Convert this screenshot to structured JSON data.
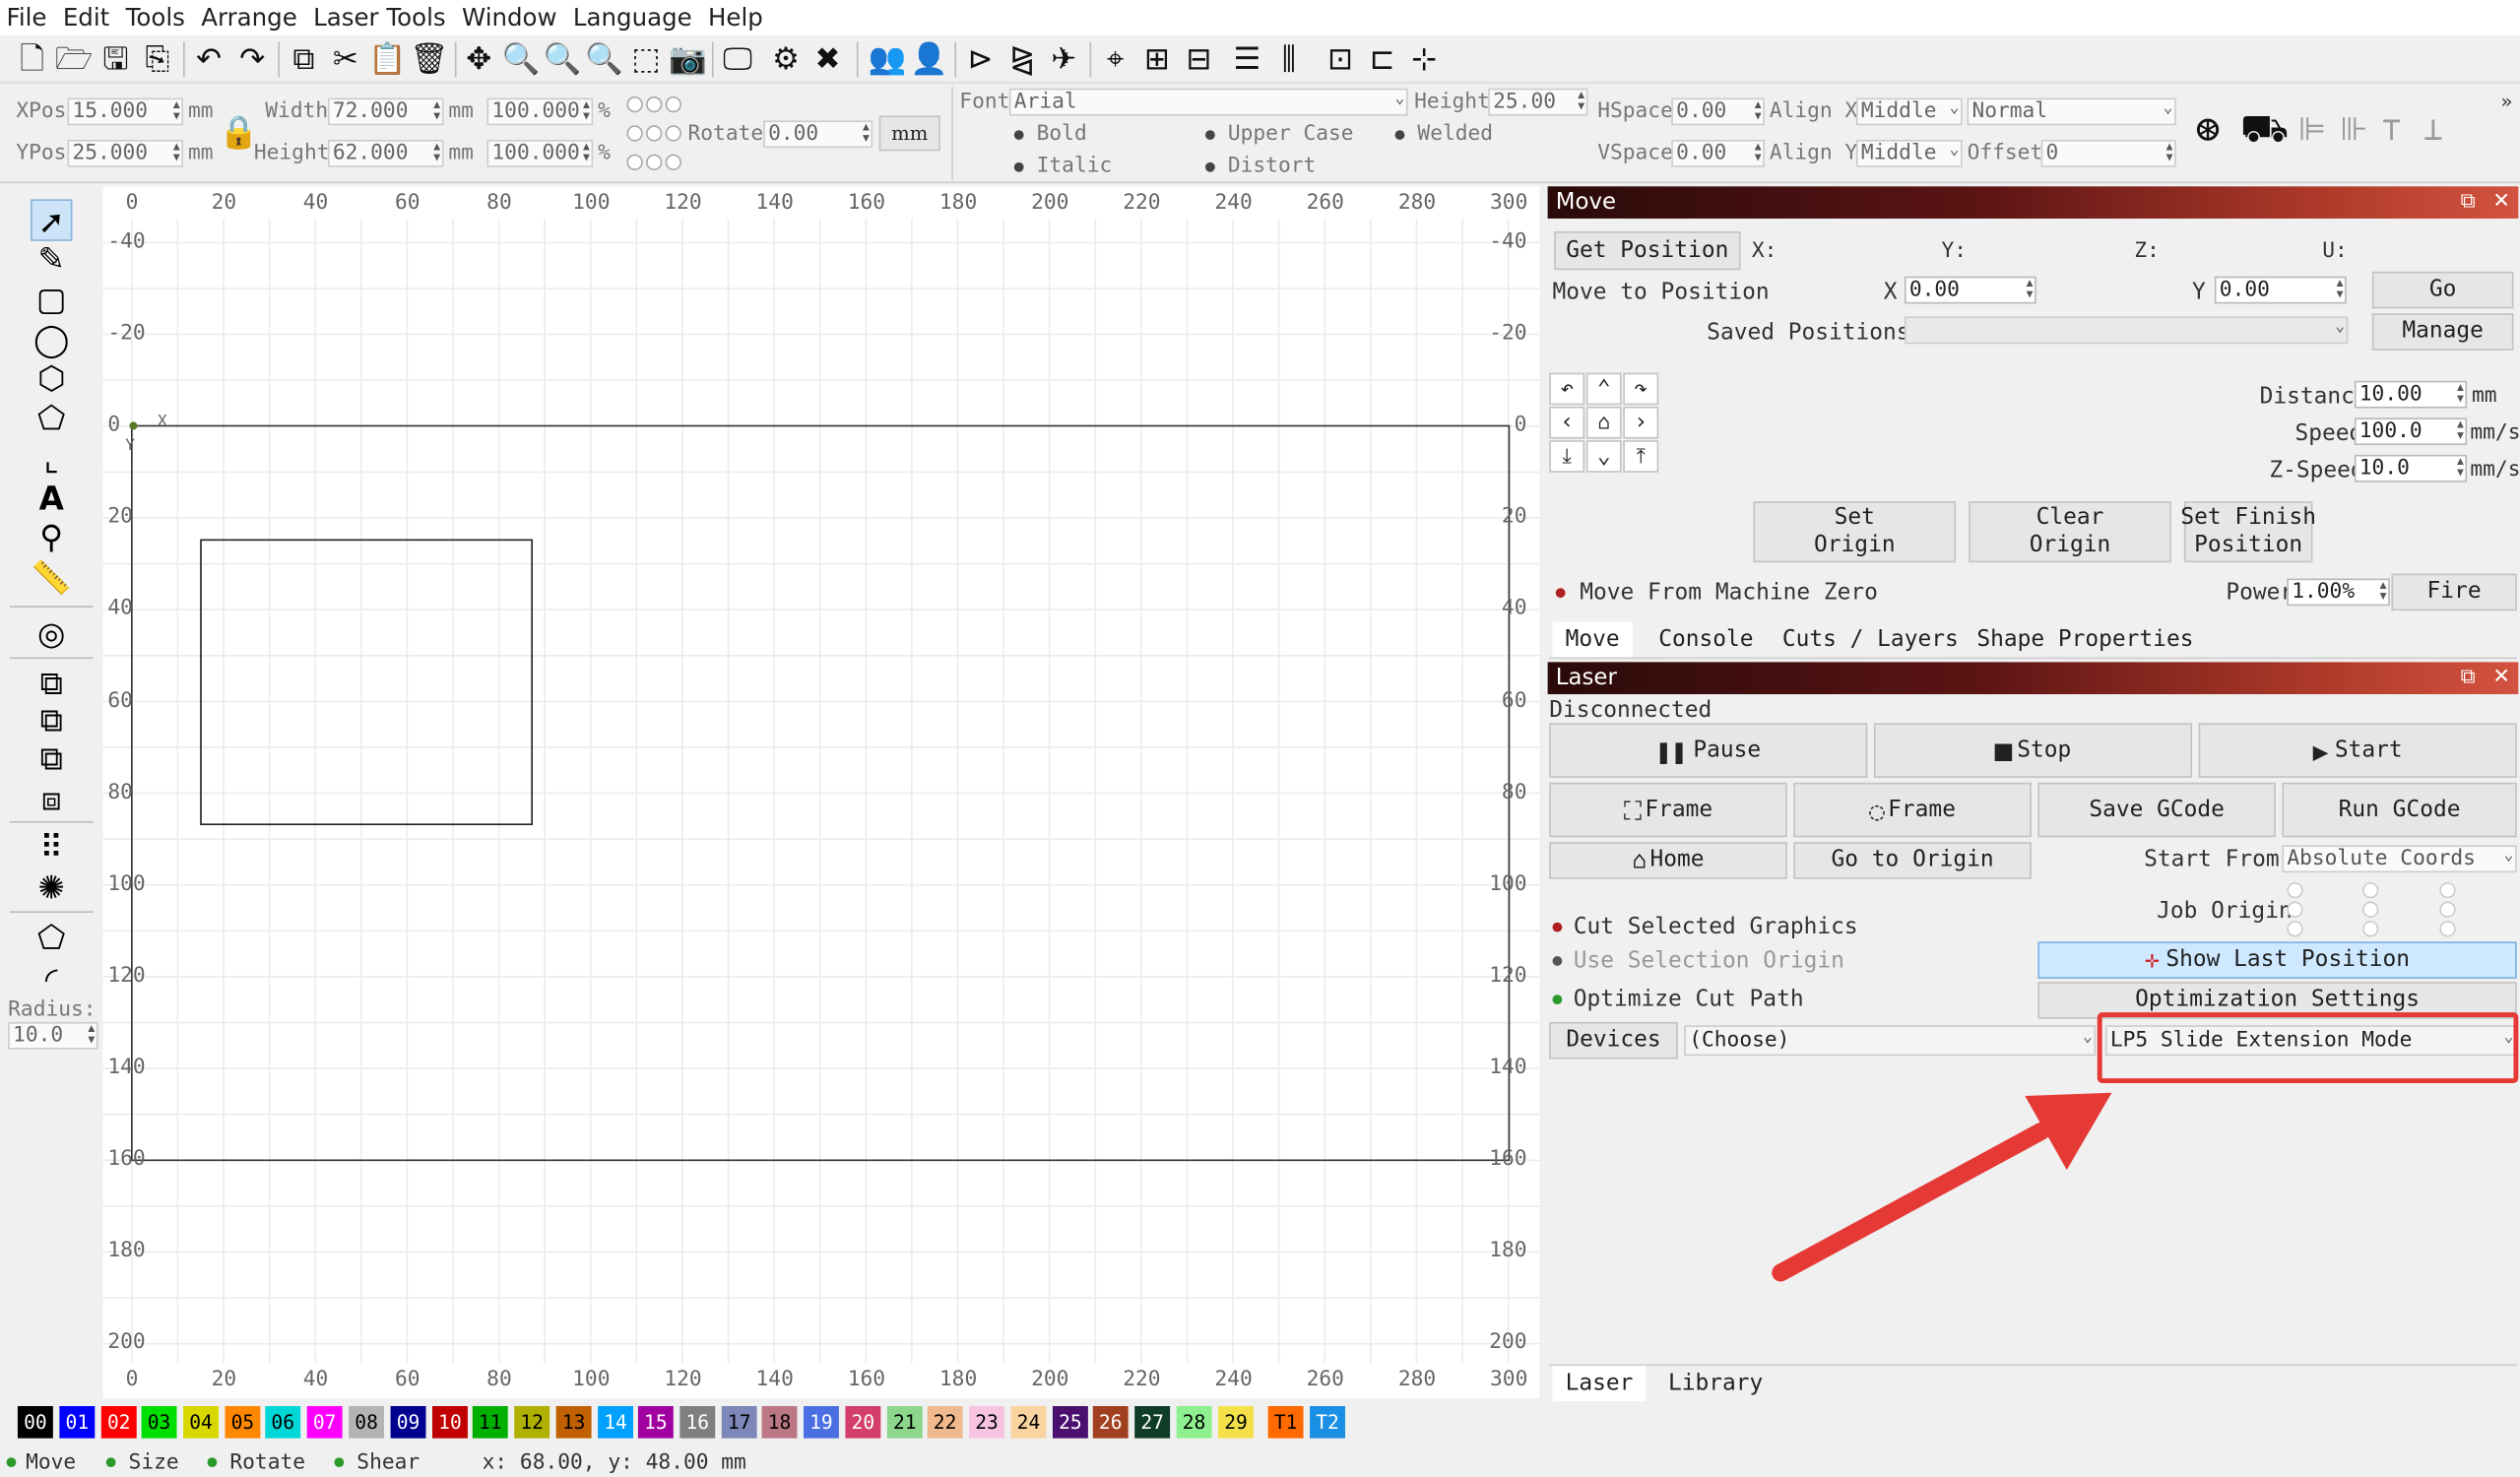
{
  "menu": [
    "File",
    "Edit",
    "Tools",
    "Arrange",
    "Laser Tools",
    "Window",
    "Language",
    "Help"
  ],
  "props": {
    "xpos_label": "XPos",
    "xpos": "15.000",
    "ypos_label": "YPos",
    "ypos": "25.000",
    "unit_mm": "mm",
    "width_label": "Width",
    "width": "72.000",
    "height_label": "Height",
    "height": "62.000",
    "scale_w": "100.000",
    "scale_h": "100.000",
    "pct": "%",
    "rotate_label": "Rotate",
    "rotate": "0.00",
    "mm_button": "mm",
    "font_label": "Font",
    "font": "Arial",
    "font_height_label": "Height",
    "font_height": "25.00",
    "bold": "Bold",
    "italic": "Italic",
    "upper_case": "Upper Case",
    "distort": "Distort",
    "welded": "Welded",
    "hspace_label": "HSpace",
    "hspace": "0.00",
    "vspace_label": "VSpace",
    "vspace": "0.00",
    "alignx_label": "Align X",
    "alignx": "Middle",
    "aligny_label": "Align Y",
    "aligny": "Middle",
    "normal": "Normal",
    "offset_label": "Offset",
    "offset": "0"
  },
  "left_tools": {
    "radius_label": "Radius:",
    "radius": "10.0"
  },
  "canvas": {
    "x_ticks": [
      "0",
      "20",
      "40",
      "60",
      "80",
      "100",
      "120",
      "140",
      "160",
      "180",
      "200",
      "220",
      "240",
      "260",
      "280",
      "300"
    ],
    "y_ticks_left": [
      "-40",
      "-20",
      "0",
      "20",
      "40",
      "60",
      "80",
      "100",
      "120",
      "140",
      "160",
      "180",
      "200"
    ],
    "y_ticks_right": [
      "-40",
      "-20",
      "0",
      "20",
      "40",
      "60",
      "80",
      "100",
      "120",
      "140",
      "160",
      "180",
      "200"
    ],
    "origin_x": "X",
    "origin_y": "Y"
  },
  "move_panel": {
    "title": "Move",
    "get_position": "Get Position",
    "x_label": "X:",
    "y_label": "Y:",
    "z_label": "Z:",
    "u_label": "U:",
    "move_to_position": "Move to Position",
    "mx_label": "X",
    "mx": "0.00",
    "my_label": "Y",
    "my": "0.00",
    "go": "Go",
    "saved_positions": "Saved Positions:",
    "manage": "Manage",
    "distance_label": "Distance",
    "distance": "10.00",
    "distance_unit": "mm",
    "speed_label": "Speed",
    "speed": "100.0",
    "speed_unit": "mm/s",
    "zspeed_label": "Z-Speed",
    "zspeed": "10.0",
    "zspeed_unit": "mm/s",
    "set_origin": [
      "Set",
      "Origin"
    ],
    "clear_origin": [
      "Clear",
      "Origin"
    ],
    "set_finish": [
      "Set Finish",
      "Position"
    ],
    "move_from_zero": "Move From Machine Zero",
    "power_label": "Power",
    "power": "1.00%",
    "fire": "Fire",
    "tabs": [
      "Move",
      "Console",
      "Cuts / Layers",
      "Shape Properties"
    ]
  },
  "laser_panel": {
    "title": "Laser",
    "status": "Disconnected",
    "pause": "Pause",
    "stop": "Stop",
    "start": "Start",
    "frame1": "Frame",
    "frame2": "Frame",
    "save_gcode": "Save GCode",
    "run_gcode": "Run GCode",
    "home": "Home",
    "go_to_origin": "Go to Origin",
    "start_from_label": "Start From:",
    "start_from": "Absolute Coords",
    "job_origin": "Job Origin",
    "cut_selected": "Cut Selected Graphics",
    "use_selection_origin": "Use Selection Origin",
    "show_last_position": "Show Last Position",
    "optimize_cut_path": "Optimize Cut Path",
    "optimization_settings": "Optimization Settings",
    "devices": "Devices",
    "devices_choice": "(Choose)",
    "device_mode": "LP5 Slide Extension Mode",
    "tabs": [
      "Laser",
      "Library"
    ]
  },
  "palette": [
    {
      "label": "00",
      "color": "#000000",
      "text": "#ffffff"
    },
    {
      "label": "01",
      "color": "#0000ff",
      "text": "#ffffff"
    },
    {
      "label": "02",
      "color": "#ff0000",
      "text": "#ffffff"
    },
    {
      "label": "03",
      "color": "#00e000",
      "text": "#000000"
    },
    {
      "label": "04",
      "color": "#d8d800",
      "text": "#000000"
    },
    {
      "label": "05",
      "color": "#ff8800",
      "text": "#000000"
    },
    {
      "label": "06",
      "color": "#00d8d8",
      "text": "#000000"
    },
    {
      "label": "07",
      "color": "#ff00ff",
      "text": "#ffffff"
    },
    {
      "label": "08",
      "color": "#b4b4b4",
      "text": "#000000"
    },
    {
      "label": "09",
      "color": "#000090",
      "text": "#ffffff"
    },
    {
      "label": "10",
      "color": "#c00000",
      "text": "#ffffff"
    },
    {
      "label": "11",
      "color": "#00b000",
      "text": "#000000"
    },
    {
      "label": "12",
      "color": "#b0b000",
      "text": "#000000"
    },
    {
      "label": "13",
      "color": "#c06000",
      "text": "#000000"
    },
    {
      "label": "14",
      "color": "#00a0ff",
      "text": "#ffffff"
    },
    {
      "label": "15",
      "color": "#a000a0",
      "text": "#ffffff"
    },
    {
      "label": "16",
      "color": "#808080",
      "text": "#ffffff"
    },
    {
      "label": "17",
      "color": "#7d87b9",
      "text": "#000000"
    },
    {
      "label": "18",
      "color": "#bb7784",
      "text": "#000000"
    },
    {
      "label": "19",
      "color": "#4a6fe3",
      "text": "#ffffff"
    },
    {
      "label": "20",
      "color": "#d33f6a",
      "text": "#ffffff"
    },
    {
      "label": "21",
      "color": "#8cd78c",
      "text": "#000000"
    },
    {
      "label": "22",
      "color": "#f0b98d",
      "text": "#000000"
    },
    {
      "label": "23",
      "color": "#f6c4e1",
      "text": "#000000"
    },
    {
      "label": "24",
      "color": "#fad4a0",
      "text": "#000000"
    },
    {
      "label": "25",
      "color": "#4a0f6f",
      "text": "#ffffff"
    },
    {
      "label": "26",
      "color": "#a04020",
      "text": "#ffffff"
    },
    {
      "label": "27",
      "color": "#0f3c28",
      "text": "#ffffff"
    },
    {
      "label": "28",
      "color": "#8ff08f",
      "text": "#000000"
    },
    {
      "label": "29",
      "color": "#f4e14a",
      "text": "#000000"
    },
    {
      "label": "T1",
      "color": "#ff6a00",
      "text": "#000000"
    },
    {
      "label": "T2",
      "color": "#1a8fe3",
      "text": "#ffffff"
    }
  ],
  "status": {
    "move": "Move",
    "size": "Size",
    "rotate": "Rotate",
    "shear": "Shear",
    "coords": "x: 68.00, y: 48.00 mm"
  },
  "colors": {
    "panel_gradient_start": "#2a0a0a",
    "panel_gradient_end": "#d2533f",
    "highlight": "#e53935",
    "selected_button": "#cde8ff"
  },
  "icons": {
    "annotation": "red-arrow-icon",
    "highlight": "red-highlight-box"
  }
}
